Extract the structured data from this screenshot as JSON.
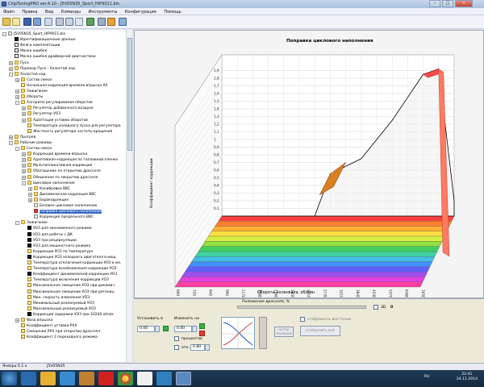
{
  "window": {
    "title": "ChipTuningPRO ver.4.10 - J5V05N35_Sport_HIP9011.bin",
    "min": "–",
    "max": "□",
    "close": "✕"
  },
  "menu": [
    "Файл",
    "Правка",
    "Вид",
    "Команды",
    "Инструменты",
    "Конфигурация",
    "Помощь"
  ],
  "tree": {
    "items": [
      {
        "text": "J5V05N35_Sport_HIP9011.bin",
        "icon": "doc",
        "exp": "-",
        "level": 0
      },
      {
        "text": "Идентификационные данные",
        "icon": "flag",
        "level": 1
      },
      {
        "text": "Флаги комплектации",
        "icon": "chk",
        "level": 1
      },
      {
        "text": "Маска ошибок",
        "icon": "chk",
        "level": 1
      },
      {
        "text": "Маска ошибок драйверной диагностики",
        "icon": "chk",
        "level": 1
      },
      {
        "text": "Пуск",
        "icon": "folder",
        "exp": "+",
        "level": 1
      },
      {
        "text": "Переход Пуск - Холостой ход",
        "icon": "folder",
        "exp": "+",
        "level": 1
      },
      {
        "text": "Холостой ход",
        "icon": "folder",
        "exp": "-",
        "level": 1
      },
      {
        "text": "Состав смеси",
        "icon": "folder",
        "exp": "+",
        "level": 2
      },
      {
        "text": "Начальная коррекция времени впрыска ХХ",
        "icon": "warn",
        "level": 2
      },
      {
        "text": "Зажигание",
        "icon": "folder",
        "exp": "+",
        "level": 2
      },
      {
        "text": "Обороты",
        "icon": "folder",
        "exp": "+",
        "level": 2
      },
      {
        "text": "Алгоритм регулирования оборотов",
        "icon": "folder",
        "exp": "-",
        "level": 2
      },
      {
        "text": "Регулятор добавочного воздуха",
        "icon": "folder",
        "exp": "+",
        "level": 3
      },
      {
        "text": "Регулятор УОЗ",
        "icon": "folder",
        "exp": "+",
        "level": 3
      },
      {
        "text": "Адаптация уставки оборотов",
        "icon": "folder",
        "exp": "+",
        "level": 3
      },
      {
        "text": "Температура холодного пуска для регулятора",
        "icon": "warn",
        "level": 3
      },
      {
        "text": "Жесткость регулятора частоты вращения",
        "icon": "warn",
        "level": 3
      },
      {
        "text": "Прогрев",
        "icon": "folder",
        "exp": "+",
        "level": 1
      },
      {
        "text": "Рабочие режимы",
        "icon": "folder",
        "exp": "-",
        "level": 1
      },
      {
        "text": "Состав смеси",
        "icon": "folder",
        "exp": "-",
        "level": 2
      },
      {
        "text": "Коррекция времени впрыска",
        "icon": "folder",
        "exp": "+",
        "level": 3
      },
      {
        "text": "Адаптивная коррекция по топливной пленке",
        "icon": "folder",
        "exp": "+",
        "level": 3
      },
      {
        "text": "Мультипликативная коррекция",
        "icon": "folder",
        "exp": "+",
        "level": 3
      },
      {
        "text": "Обогащение по открытию дросселя",
        "icon": "folder",
        "exp": "+",
        "level": 3
      },
      {
        "text": "Обеднение по закрытию дросселя",
        "icon": "folder",
        "exp": "+",
        "level": 3
      },
      {
        "text": "Цикловое наполнение",
        "icon": "folder",
        "exp": "-",
        "level": 3
      },
      {
        "text": "Калибровка ВВС",
        "icon": "folder",
        "exp": "+",
        "level": 4
      },
      {
        "text": "Динамическая коррекция ВВС",
        "icon": "folder",
        "exp": "+",
        "level": 4
      },
      {
        "text": "Барокоррекция",
        "icon": "folder",
        "exp": "+",
        "level": 4
      },
      {
        "text": "Базовое цикловое наполнение",
        "icon": "doc",
        "level": 4
      },
      {
        "text": "Поправка циклового наполнения",
        "icon": "red",
        "level": 4,
        "selected": true
      },
      {
        "text": "Коррекция предельного ВВС",
        "icon": "doc",
        "level": 4
      },
      {
        "text": "Зажигание",
        "icon": "folder",
        "exp": "-",
        "level": 2
      },
      {
        "text": "УОЗ для экономичного режима",
        "icon": "flag",
        "level": 3
      },
      {
        "text": "УОЗ для работы с ДК",
        "icon": "flag",
        "level": 3
      },
      {
        "text": "УОЗ при рециркуляции",
        "icon": "flag",
        "level": 3
      },
      {
        "text": "УОЗ для мощностного режима",
        "icon": "flag",
        "level": 3
      },
      {
        "text": "Коррекция УОЗ по температуре",
        "icon": "warn",
        "level": 3
      },
      {
        "text": "Коррекция УОЗ холодного двигателя в мощ.",
        "icon": "flag",
        "level": 3
      },
      {
        "text": "Температура отключения коррекции УОЗ в мо.",
        "icon": "warn",
        "level": 3
      },
      {
        "text": "Температура возобновления коррекции УОЗ",
        "icon": "warn",
        "level": 3
      },
      {
        "text": "Коэффициент динамической коррекции УОЗ",
        "icon": "flag",
        "level": 3
      },
      {
        "text": "Температура включения коррекции УОЗ",
        "icon": "warn",
        "level": 3
      },
      {
        "text": "Максимальное смещение УОЗ при динамич.",
        "icon": "warn",
        "level": 3
      },
      {
        "text": "Максимальное смещение УОЗ при детонац.",
        "icon": "warn",
        "level": 3
      },
      {
        "text": "Мин. скорость изменения УОЗ",
        "icon": "warn",
        "level": 3
      },
      {
        "text": "Минимальный реализуемый УОЗ",
        "icon": "warn",
        "level": 3
      },
      {
        "text": "Максимальный реализуемый УОЗ",
        "icon": "warn",
        "level": 3
      },
      {
        "text": "Коррекция задержки УОЗ при 10240 обл/м",
        "icon": "flag",
        "level": 3
      },
      {
        "text": "Фаза впрыска",
        "icon": "folder",
        "exp": "+",
        "level": 2
      },
      {
        "text": "Коэффициент уставки РХХ",
        "icon": "warn",
        "level": 2
      },
      {
        "text": "Смещение РХХ при открытии дросселя",
        "icon": "warn",
        "level": 2
      },
      {
        "text": "Коэффициент 2 переходного режима",
        "icon": "warn",
        "level": 2
      }
    ]
  },
  "chart_data": {
    "type": "3d-surface",
    "title": "Поправка циклового наполнения",
    "xlabel": "Обороты коленвала, об/мин",
    "ylabel": "Коэффициент коррекции",
    "zlabel": "Положение дросселя, %",
    "x_ticks": [
      "600",
      "720",
      "840",
      "990",
      "1170",
      "1380",
      "1560",
      "1950",
      "2310",
      "2730",
      "3210",
      "3840",
      "4530",
      "5370",
      "6360",
      "7650"
    ],
    "y_ticks": [
      "0,1",
      "0,2",
      "0,3",
      "0,4",
      "0,5",
      "0,6",
      "0,7",
      "0,8",
      "0,9",
      "1",
      "1,1",
      "1,2",
      "1,3",
      "1,4",
      "1,5",
      "1,6",
      "1,7",
      "1,8",
      "1,9"
    ],
    "ylim": [
      0,
      2
    ],
    "profile": [
      {
        "rpm": "600",
        "value": 0.0
      },
      {
        "rpm": "1560",
        "value": 0.0
      },
      {
        "rpm": "1950",
        "value": 0.55
      },
      {
        "rpm": "2730",
        "value": 0.75
      },
      {
        "rpm": "3840",
        "value": 1.25
      },
      {
        "rpm": "5370",
        "value": 1.85
      },
      {
        "rpm": "6360",
        "value": 1.92
      },
      {
        "rpm": "7650",
        "value": 0.2
      }
    ],
    "layer_colors": [
      "#ff4040",
      "#ff8030",
      "#ffb030",
      "#ffe040",
      "#d8f040",
      "#90e040",
      "#40d060",
      "#40d0a0",
      "#40c0e0",
      "#4090ff",
      "#6060ff",
      "#a050f0",
      "#e040e0",
      "#ff40a0"
    ],
    "grid": true
  },
  "bottom": {
    "set_to_label": "Установить в",
    "set_to_value": "0.00",
    "change_by_label": "Изменить на",
    "change_by_value": "0.00",
    "percent_label": "процентов",
    "from_label": "отн.",
    "from_value": "0.80",
    "interp_btn": "интер\nполяция",
    "show_all_points": "отображать все точки",
    "display_all_btn": "отобразить все",
    "three_d_label": "3D",
    "three_d_value": "0"
  },
  "status": {
    "left": "Январь-5.1.x",
    "right": "J5V05N35"
  },
  "taskbar": {
    "lang": "RU",
    "time": "22:41",
    "date": "24.11.2014"
  },
  "colors": {
    "accent": "#3168c6",
    "title_bar": "#aac0dc",
    "taskbar": "#1f3b56"
  }
}
